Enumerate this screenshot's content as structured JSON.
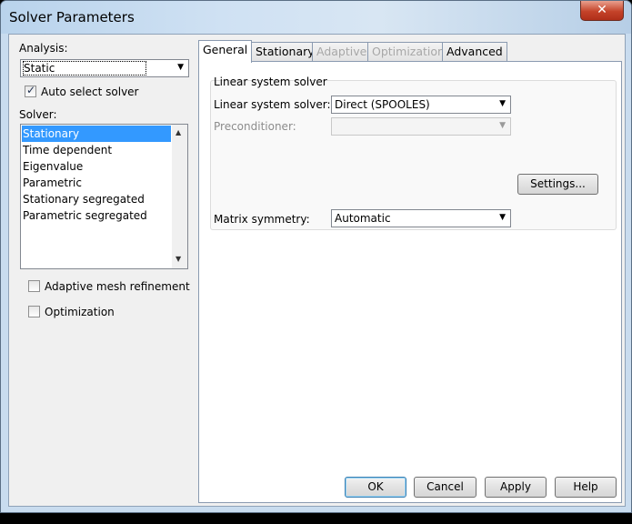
{
  "window": {
    "title": "Solver Parameters",
    "close_icon": "close-icon"
  },
  "analysis": {
    "label": "Analysis:",
    "value": "Static"
  },
  "auto_select": {
    "label": "Auto select solver",
    "checked": true
  },
  "solver": {
    "label": "Solver:",
    "items": [
      {
        "label": "Stationary",
        "selected": true
      },
      {
        "label": "Time dependent",
        "selected": false
      },
      {
        "label": "Eigenvalue",
        "selected": false
      },
      {
        "label": "Parametric",
        "selected": false
      },
      {
        "label": "Stationary segregated",
        "selected": false
      },
      {
        "label": "Parametric segregated",
        "selected": false
      }
    ]
  },
  "options": {
    "adaptive": {
      "label": "Adaptive mesh refinement",
      "checked": false
    },
    "optimization": {
      "label": "Optimization",
      "checked": false
    }
  },
  "tabs": [
    {
      "label": "General",
      "active": true,
      "enabled": true
    },
    {
      "label": "Stationary",
      "active": false,
      "enabled": true
    },
    {
      "label": "Adaptive",
      "active": false,
      "enabled": false
    },
    {
      "label": "Optimization",
      "active": false,
      "enabled": false
    },
    {
      "label": "Advanced",
      "active": false,
      "enabled": true
    }
  ],
  "general": {
    "group_title": "Linear system solver",
    "linear_solver": {
      "label": "Linear system solver:",
      "value": "Direct (SPOOLES)"
    },
    "preconditioner": {
      "label": "Preconditioner:",
      "value": ""
    },
    "settings_button": "Settings...",
    "matrix_symmetry": {
      "label": "Matrix symmetry:",
      "value": "Automatic"
    }
  },
  "buttons": {
    "ok": "OK",
    "cancel": "Cancel",
    "apply": "Apply",
    "help": "Help"
  },
  "colors": {
    "accent_selection": "#3399ff",
    "close_button": "#c4432a"
  }
}
